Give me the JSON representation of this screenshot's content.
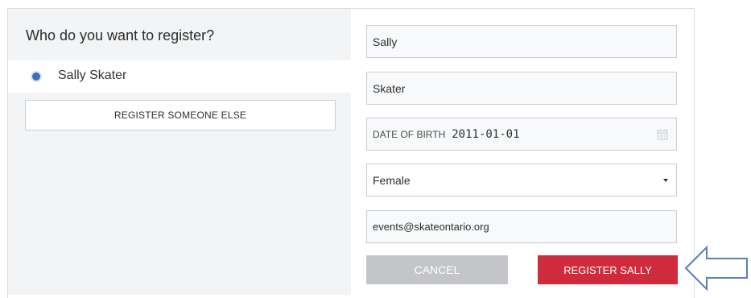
{
  "form": {
    "question": "Who do you want to register?",
    "selected_skater": "Sally Skater",
    "register_someone_else_label": "REGISTER SOMEONE ELSE",
    "first_name": "Sally",
    "last_name": "Skater",
    "date_of_birth_label": "DATE OF BIRTH",
    "date_of_birth_value": "2011-01-01",
    "gender_selected": "Female",
    "email": "events@skateontario.org",
    "cancel_label": "CANCEL",
    "register_label": "REGISTER SALLY"
  },
  "colors": {
    "accent_red": "#d02b3c",
    "radio_blue": "#3e6fb3",
    "cancel_gray": "#c3c5c8",
    "arrow_blue": "#5a7fb8"
  },
  "icons": {
    "calendar": "calendar-icon",
    "caret": "caret-down-icon",
    "pointer": "arrow-left-icon"
  }
}
